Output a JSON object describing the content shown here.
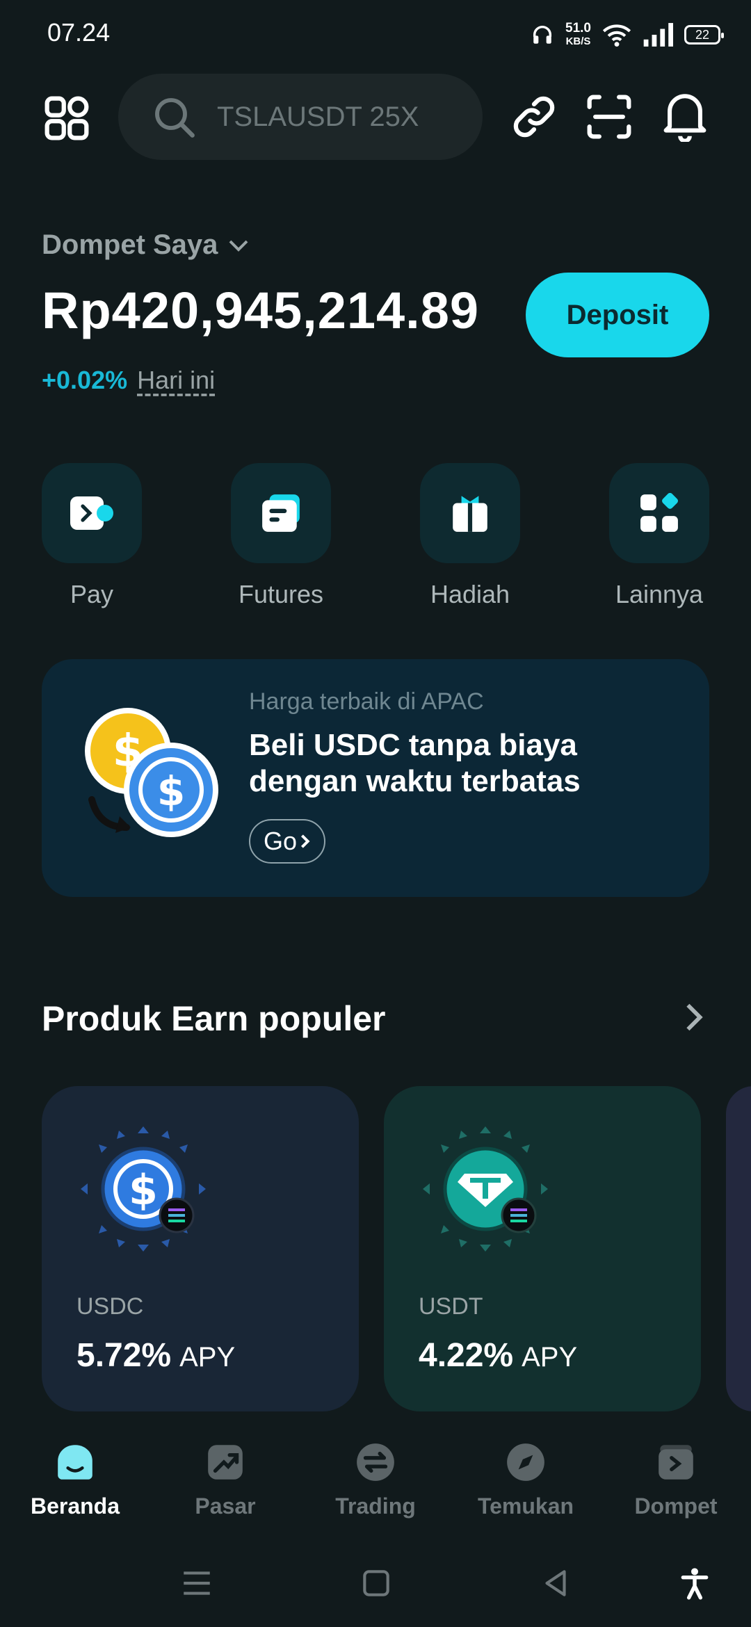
{
  "status_bar": {
    "time": "07.24",
    "net_speed_value": "51.0",
    "net_speed_unit": "KB/S",
    "battery": "22"
  },
  "header": {
    "search_placeholder": "TSLAUSDT 25X",
    "icons": [
      "apps-icon",
      "search-icon",
      "link-icon",
      "scan-icon",
      "bell-icon"
    ]
  },
  "wallet": {
    "label": "Dompet Saya",
    "balance": "Rp420,945,214.89",
    "change_pct": "+0.02%",
    "change_period": "Hari ini",
    "deposit_label": "Deposit"
  },
  "shortcuts": [
    {
      "label": "Pay",
      "icon": "pay-icon"
    },
    {
      "label": "Futures",
      "icon": "futures-icon"
    },
    {
      "label": "Hadiah",
      "icon": "gift-icon"
    },
    {
      "label": "Lainnya",
      "icon": "more-icon"
    }
  ],
  "banner": {
    "kicker": "Harga terbaik di APAC",
    "title": "Beli USDC tanpa biaya dengan waktu terbatas",
    "cta": "Go"
  },
  "earn": {
    "title": "Produk Earn populer",
    "cards": [
      {
        "name": "USDC",
        "apy": "5.72%",
        "apy_label": "APY"
      },
      {
        "name": "USDT",
        "apy": "4.22%",
        "apy_label": "APY"
      }
    ]
  },
  "bottom_nav": [
    {
      "label": "Beranda",
      "active": true
    },
    {
      "label": "Pasar",
      "active": false
    },
    {
      "label": "Trading",
      "active": false
    },
    {
      "label": "Temukan",
      "active": false
    },
    {
      "label": "Dompet",
      "active": false
    }
  ],
  "colors": {
    "background": "#111a1c",
    "accent": "#19d7eb",
    "change_positive": "#19b8d6",
    "muted_text": "#9aa4a6"
  }
}
